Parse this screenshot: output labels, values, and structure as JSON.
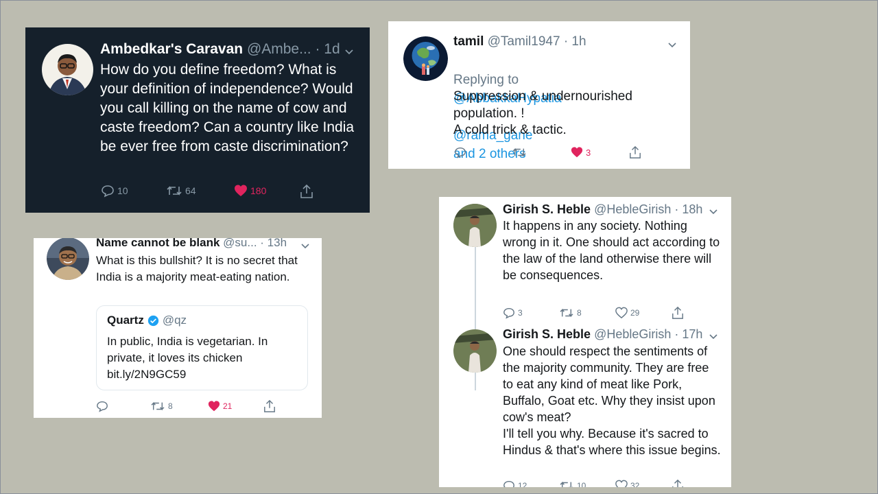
{
  "tweets": {
    "ambedkar": {
      "name": "Ambedkar's Caravan",
      "handle": "@Ambe...",
      "time": "· 1d",
      "text": "How do you define freedom? What is your definition of independence? Would you call killing on the name of cow and caste freedom? Can a country like India be ever free from caste discrimination?",
      "replies": "10",
      "retweets": "64",
      "likes": "180"
    },
    "tamil": {
      "name": "tamil",
      "handle": "@Tamil1947",
      "time": "· 1h",
      "replying_prefix": "Replying to",
      "replying_to_1": "@AbbakkaHypatia",
      "replying_to_2": "@rama_gane",
      "replying_and": "and 2 others",
      "text": "Suppression & undernourished\npopulation. !\nA cold trick & tactic.",
      "likes": "3"
    },
    "nameblank": {
      "name": "Name cannot be blank",
      "handle": "@su...",
      "time": "· 13h",
      "text": "What is this bullshit? It is no secret that India is a majority meat-eating nation.",
      "quote_name": "Quartz",
      "quote_handle": "@qz",
      "quote_text": "In public, India is vegetarian. In\nprivate, it loves its chicken\nbit.ly/2N9GC59",
      "retweets": "8",
      "likes": "21"
    },
    "girish1": {
      "name": "Girish S. Heble",
      "handle": "@HebleGirish",
      "time": "· 18h",
      "text": "It happens in any society. Nothing wrong in it. One should act according to the law of the land otherwise there will be consequences.",
      "replies": "3",
      "retweets": "8",
      "likes": "29"
    },
    "girish2": {
      "name": "Girish S. Heble",
      "handle": "@HebleGirish",
      "time": "· 17h",
      "text": "One should respect the sentiments of the majority community. They are free to eat any kind of meat like Pork, Buffalo, Goat etc. Why they insist upon cow's meat?\nI'll tell you why. Because it's sacred to Hindus & that's where this issue begins.",
      "replies": "12",
      "retweets": "10",
      "likes": "32"
    }
  },
  "icons": [
    "reply-icon",
    "retweet-icon",
    "like-icon",
    "share-icon",
    "chevron-down-icon",
    "verified-icon"
  ],
  "colors": {
    "background": "#bcbcb0",
    "dark_card": "#15202b",
    "like_active": "#e0245e",
    "link": "#1b95e0",
    "verified": "#1da1f2"
  }
}
